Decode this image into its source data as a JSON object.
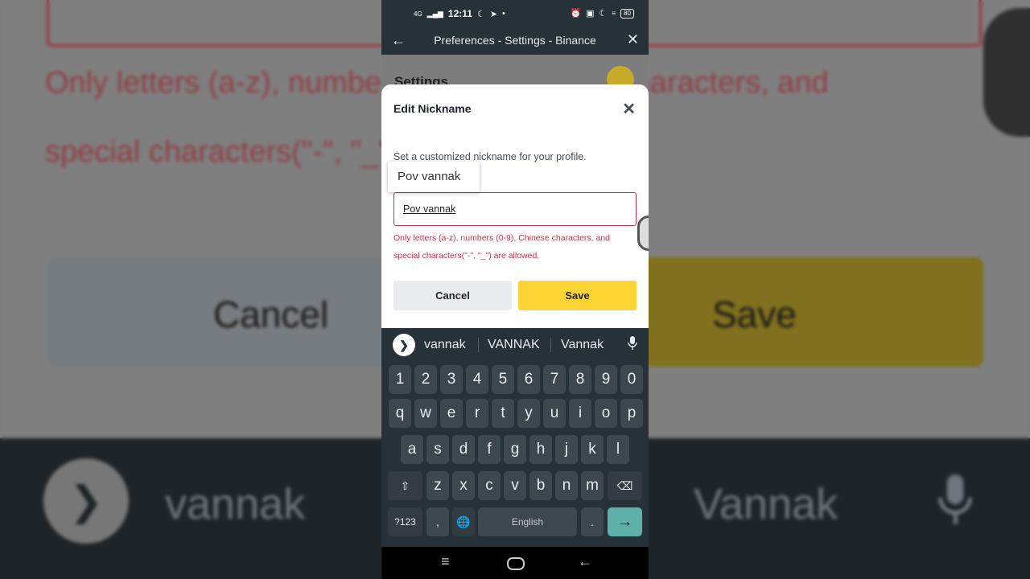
{
  "background": {
    "error_line1": "Only letters (a-z), numbers (0-9), Chinese characters, and",
    "error_line2": "special characters(\"-\", \"_\") are allowed.",
    "cancel_label": "Cancel",
    "save_label": "Save",
    "suggestion_1": "vannak",
    "suggestion_3": "Vannak"
  },
  "status_bar": {
    "network": "4G",
    "time": "12:11",
    "battery": "80"
  },
  "app_bar": {
    "title": "Preferences - Settings - Binance"
  },
  "page_behind": {
    "title": "Settings"
  },
  "dialog": {
    "title": "Edit Nickname",
    "description": "Set a customized nickname for your profile.",
    "autocomplete_popup": "Pov vannak",
    "input_value": "Pov vannak",
    "error_line1": "Only letters (a-z), numbers (0-9), Chinese characters, and",
    "error_line2": "special characters(\"-\", \"_\") are allowed.",
    "cancel_label": "Cancel",
    "save_label": "Save"
  },
  "keyboard": {
    "suggestions": [
      "vannak",
      "VANNAK",
      "Vannak"
    ],
    "row_numbers": [
      "1",
      "2",
      "3",
      "4",
      "5",
      "6",
      "7",
      "8",
      "9",
      "0"
    ],
    "row_top": [
      "q",
      "w",
      "e",
      "r",
      "t",
      "y",
      "u",
      "i",
      "o",
      "p"
    ],
    "row_middle": [
      "a",
      "s",
      "d",
      "f",
      "g",
      "h",
      "j",
      "k",
      "l"
    ],
    "row_bottom": [
      "z",
      "x",
      "c",
      "v",
      "b",
      "n",
      "m"
    ],
    "symbols_label": "?123",
    "comma_label": ",",
    "space_label": "English",
    "period_label": "."
  },
  "colors": {
    "error_red": "#cf304a",
    "binance_yellow": "#fcd535",
    "keyboard_bg": "#263238"
  }
}
